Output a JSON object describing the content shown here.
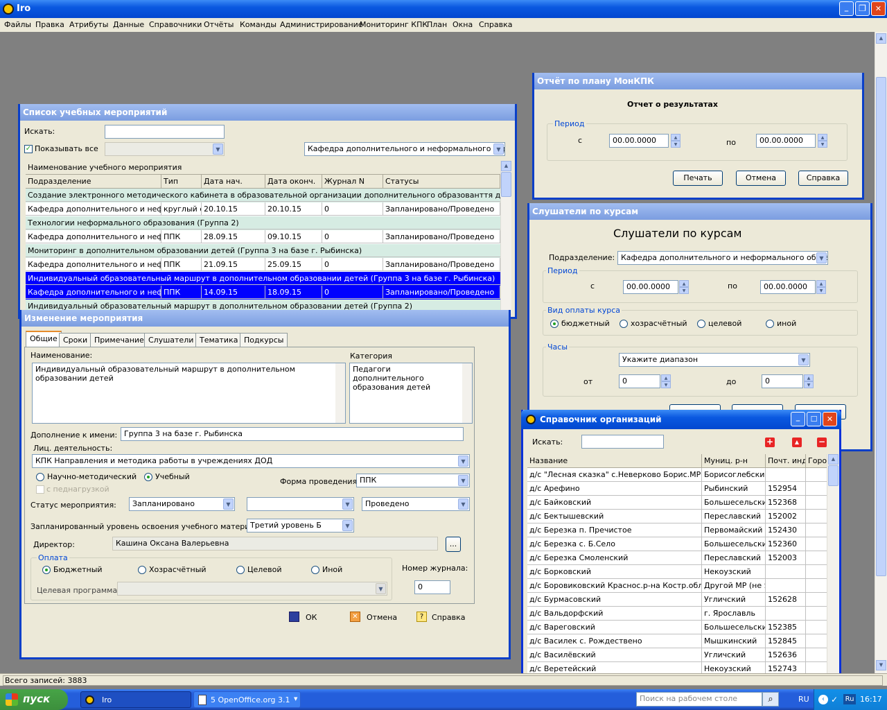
{
  "app": {
    "title": "Iro"
  },
  "menu": [
    "Файлы",
    "Правка",
    "Атрибуты",
    "Данные",
    "Справочники",
    "Отчёты",
    "Команды",
    "Администрирование",
    "Мониторинг КПК",
    "План",
    "Окна",
    "Справка"
  ],
  "status_bar": "Всего записей: 3883",
  "list_window": {
    "title": "Список учебных мероприятий",
    "search_label": "Искать:",
    "show_all_label": "Показывать все",
    "dept_select": "Кафедра дополнительного и неформального образо",
    "header_top": "Наименование учебного мероприятия",
    "columns": [
      "Подразделение",
      "Тип",
      "Дата нач.",
      "Дата оконч.",
      "Журнал N",
      "Статусы"
    ],
    "rows": [
      {
        "kind": "group",
        "name": "Создание электронного методического кабинета в образовательной организации дополнительного образованття детей"
      },
      {
        "kind": "data",
        "cells": [
          "Кафедра дополнительного и неформ",
          "круглый с",
          "20.10.15",
          "20.10.15",
          "0",
          "Запланировано/Проведено"
        ]
      },
      {
        "kind": "group",
        "name": "Технологии неформального образования (Группа 2)"
      },
      {
        "kind": "data",
        "cells": [
          "Кафедра дополнительного и неформ",
          "ППК",
          "28.09.15",
          "09.10.15",
          "0",
          "Запланировано/Проведено"
        ]
      },
      {
        "kind": "group",
        "name": "Мониторинг в дополнительном образовании детей (Группа 3 на базе г. Рыбинска)"
      },
      {
        "kind": "data",
        "cells": [
          "Кафедра дополнительного и неформ",
          "ППК",
          "21.09.15",
          "25.09.15",
          "0",
          "Запланировано/Проведено"
        ]
      },
      {
        "kind": "selgroup",
        "name": "Индивидуальный образовательный маршрут в дополнительном образовании детей (Группа 3  на базе г. Рыбинска)"
      },
      {
        "kind": "seldata",
        "cells": [
          "Кафедра дополнительного и неформ",
          "ППК",
          "14.09.15",
          "18.09.15",
          "0",
          "Запланировано/Проведено"
        ]
      },
      {
        "kind": "group",
        "name": "Индивидуальный образовательный маршрут в дополнительном образовании детей (Группа 2)"
      }
    ]
  },
  "edit_window": {
    "title": "Изменение мероприятия",
    "tabs": [
      "Общие",
      "Сроки",
      "Примечание",
      "Слушатели",
      "Тематика",
      "Подкурсы"
    ],
    "name_label": "Наименование:",
    "name_value": "Индивидуальный образовательный маршрут в дополнительном образовании детей",
    "category_label": "Категория",
    "category_value": "Педагоги дополнительного образования детей",
    "addition_label": "Дополнение к имени:",
    "addition_value": "Группа 3  на базе г. Рыбинска",
    "activity_label": "Лиц. деятельность:",
    "activity_value": "КПК Направления и методика работы в учреждениях ДОД",
    "radio_sci": "Научно-методический",
    "radio_edu": "Учебный",
    "chk_ped": "с педнагрузкой",
    "form_label": "Форма проведения:",
    "form_value": "ППК",
    "status_label": "Статус мероприятия:",
    "status_value": "Запланировано",
    "status_value2": "",
    "status_value3": "Проведено",
    "level_label": "Запланированный уровень освоения учебного материала:",
    "level_value": "Третий уровень Б",
    "director_label": "Директор:",
    "director_value": "Кашина Оксана Валерьевна",
    "director_btn": "...",
    "pay_group": "Оплата",
    "pay_options": [
      "Бюджетный",
      "Хозрасчётный",
      "Целевой",
      "Иной"
    ],
    "journal_label": "Номер журнала:",
    "journal_value": "0",
    "target_label": "Целевая программа:",
    "ok": "ОК",
    "cancel": "Отмена",
    "help": "Справка"
  },
  "report_window": {
    "title": "Отчёт по плану МонКПК",
    "heading": "Отчет о результатах",
    "period": "Период",
    "from_label": "с",
    "to_label": "по",
    "from_value": "00.00.0000",
    "to_value": "00.00.0000",
    "print": "Печать",
    "cancel": "Отмена",
    "help": "Справка"
  },
  "students_window": {
    "title": "Слушатели по курсам",
    "heading": "Слушатели по курсам",
    "dept_label": "Подразделение:",
    "dept_value": "Кафедра дополнительного и неформального образова",
    "period": "Период",
    "from_label": "с",
    "to_label": "по",
    "from_value": "00.00.0000",
    "to_value": "00.00.0000",
    "pay_group": "Вид оплаты курса",
    "pay_options": [
      "бюджетный",
      "хозрасчётный",
      "целевой",
      "иной"
    ],
    "hours_group": "Часы",
    "hours_select": "Укажите диапазон",
    "hours_from_label": "от",
    "hours_to_label": "до",
    "hours_from": "0",
    "hours_to": "0"
  },
  "org_window": {
    "title": "Справочник организаций",
    "search_label": "Искать:",
    "columns": [
      "Название",
      "Муниц. р-н",
      "Почт. инд",
      "Горо"
    ],
    "rows": [
      [
        "д/с \"Лесная сказка\" с.Неверково Борис.МР",
        "Борисоглебский",
        ""
      ],
      [
        "д/с Арефино",
        "Рыбинский",
        "152954"
      ],
      [
        "д/с Байковский",
        "Большесельский",
        "152368"
      ],
      [
        "д/с Бектышевский",
        "Переславский",
        "152002"
      ],
      [
        "д/с Березка п. Пречистое",
        "Первомайский",
        "152430"
      ],
      [
        "д/с Березка с. Б.Село",
        "Большесельский",
        "152360"
      ],
      [
        "д/с Березка Смоленский",
        "Переславский",
        "152003"
      ],
      [
        "д/с Борковский",
        "Некоузский",
        ""
      ],
      [
        "д/с Боровиковский Краснос.р-на Костр.обл",
        "Другой МР (не Я(",
        ""
      ],
      [
        "д/с Бурмасовский",
        "Угличский",
        "152628"
      ],
      [
        "д/с Вальдорфский",
        "г. Ярославль",
        ""
      ],
      [
        "д/с Вареговский",
        "Большесельский",
        "152385"
      ],
      [
        "д/с Василек с. Рождествено",
        "Мышкинский",
        "152845"
      ],
      [
        "д/с Василёвский",
        "Угличский",
        "152636"
      ],
      [
        "д/с Веретейский",
        "Некоузский",
        "152743"
      ]
    ]
  },
  "taskbar": {
    "start": "пуск",
    "tasks": [
      "Iro",
      "5 OpenOffice.org 3.1"
    ],
    "search_placeholder": "Поиск на рабочем столе",
    "lang": "RU",
    "lang2": "Ru",
    "clock": "16:17"
  }
}
